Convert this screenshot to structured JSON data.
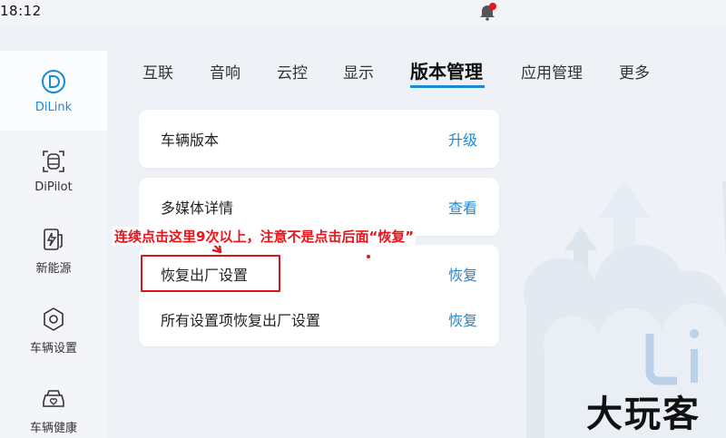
{
  "status_bar": {
    "time": "18:12"
  },
  "sidebar": {
    "items": [
      {
        "label": "DiLink",
        "icon": "dilink-icon",
        "active": true
      },
      {
        "label": "DiPilot",
        "icon": "dipilot-icon",
        "active": false
      },
      {
        "label": "新能源",
        "icon": "energy-icon",
        "active": false
      },
      {
        "label": "车辆设置",
        "icon": "hexagon-settings-icon",
        "active": false
      },
      {
        "label": "车辆健康",
        "icon": "car-health-icon",
        "active": false
      }
    ]
  },
  "tabs": [
    {
      "label": "互联"
    },
    {
      "label": "音响"
    },
    {
      "label": "云控"
    },
    {
      "label": "显示"
    },
    {
      "label": "版本管理",
      "active": true
    },
    {
      "label": "应用管理"
    },
    {
      "label": "更多"
    }
  ],
  "cards": {
    "vehicle_version": {
      "title": "车辆版本",
      "action": "升级"
    },
    "media_details": {
      "title": "多媒体详情",
      "action": "查看"
    },
    "factory_reset": {
      "title": "恢复出厂设置",
      "action": "恢复"
    },
    "reset_all": {
      "title": "所有设置项恢复出厂设置",
      "action": "恢复"
    }
  },
  "annotation": {
    "text": "连续点击这里9次以上，注意不是点击后面“恢复”"
  },
  "watermark": "大玩客",
  "colors": {
    "accent": "#1a8ad6",
    "annotation_red": "#e8141a",
    "background": "#eef1f5"
  }
}
